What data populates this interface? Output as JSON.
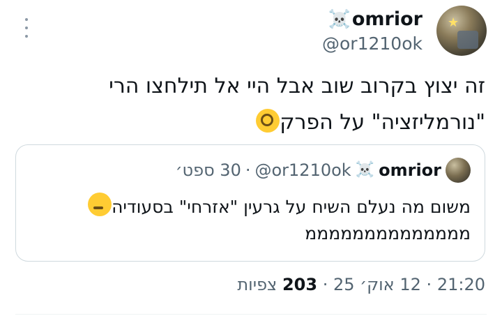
{
  "author": {
    "skull": "☠️",
    "name": "omrior",
    "handle": "@or1210ok"
  },
  "tweet": {
    "line1": "זה יצוץ בקרוב שוב אבל היי אל תילחצו הרי",
    "line2": "\"נורמליזציה\" על הפרק",
    "emoji_name": "face-with-monocle"
  },
  "quote": {
    "skull": "☠️",
    "name": "omrior",
    "handle": "@or1210ok",
    "separator": "·",
    "date": "30 ספט׳",
    "line1": "משום מה נעלם השיח על גרעין \"אזרחי\" בסעודיה",
    "line2": "ממממממממממממממ",
    "emoji_name": "thinking-face"
  },
  "meta": {
    "time": "21:20",
    "sep1": "·",
    "date": "12 אוק׳ 25",
    "sep2": "·",
    "views_count": "203",
    "views_label": "צפיות"
  }
}
